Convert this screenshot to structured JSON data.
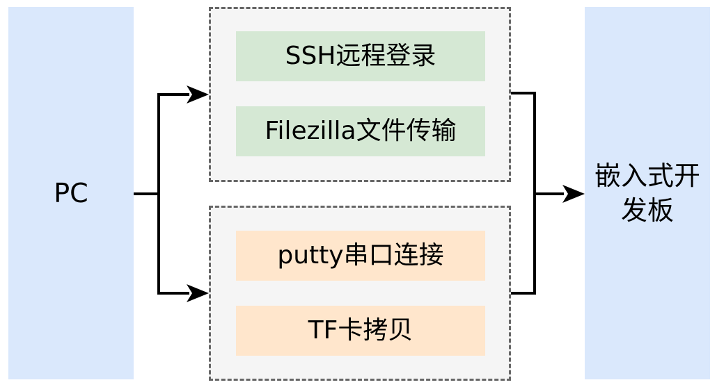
{
  "pc": {
    "label": "PC"
  },
  "board": {
    "label": "嵌入式开发板"
  },
  "groups": [
    {
      "items": [
        {
          "label": "SSH远程登录"
        },
        {
          "label": "Filezilla文件传输"
        }
      ]
    },
    {
      "items": [
        {
          "label": "putty串口连接"
        },
        {
          "label": "TF卡拷贝"
        }
      ]
    }
  ],
  "colors": {
    "endpoint_fill": "#dae8fc",
    "group_fill": "#f5f5f5",
    "group_border": "#666666",
    "network_item_fill": "#d5e8d4",
    "local_item_fill": "#ffe6cc"
  }
}
